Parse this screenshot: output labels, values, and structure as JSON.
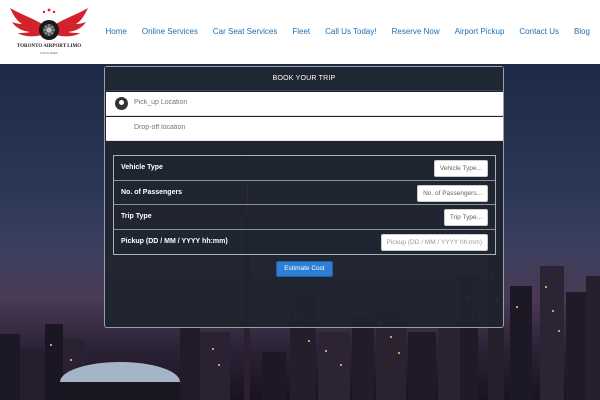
{
  "logo": {
    "name": "TORONTO AIRPORT LIMO",
    "tagline": "GTA & AREA"
  },
  "nav": {
    "items": [
      {
        "label": "Home"
      },
      {
        "label": "Online Services"
      },
      {
        "label": "Car Seat Services"
      },
      {
        "label": "Fleet"
      },
      {
        "label": "Call Us Today!"
      },
      {
        "label": "Reserve Now"
      },
      {
        "label": "Airport Pickup"
      },
      {
        "label": "Contact Us"
      },
      {
        "label": "Blog"
      }
    ]
  },
  "booking": {
    "title": "BOOK YOUR TRIP",
    "pickup_placeholder": "Pick_up Location",
    "dropoff_placeholder": "Drop-off location",
    "fields": [
      {
        "label": "Vehicle Type",
        "placeholder": "Vehicle Type..."
      },
      {
        "label": "No. of Passengers",
        "placeholder": "No. of Passengers..."
      },
      {
        "label": "Trip Type",
        "placeholder": "Trip Type..."
      },
      {
        "label": "Pickup (DD / MM / YYYY hh:mm)",
        "placeholder": "Pickup (DD / MM / YYYY hh:mm)"
      }
    ],
    "estimate_label": "Estimate Cost"
  },
  "colors": {
    "nav_link": "#1f6fb5",
    "panel_bg": "#1e242e",
    "button": "#2d7fd6",
    "logo_red": "#d2232a"
  }
}
